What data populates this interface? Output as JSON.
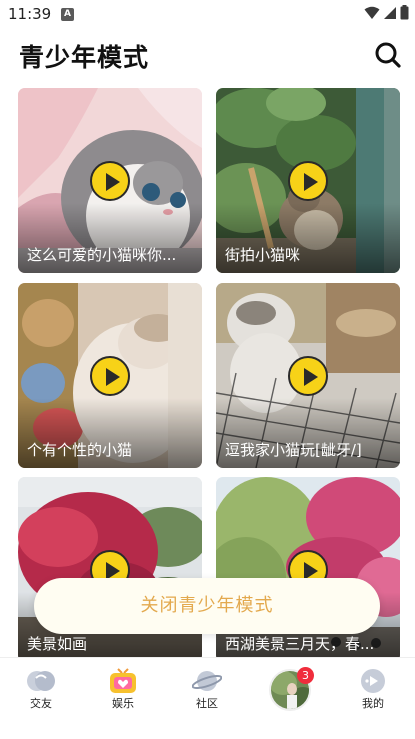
{
  "status_bar": {
    "time": "11:39",
    "app_icon": "A",
    "icons": [
      "wifi-icon",
      "cellular-signal-icon",
      "battery-icon"
    ]
  },
  "header": {
    "title": "青少年模式",
    "search_icon": "search-icon"
  },
  "videos": [
    {
      "title": "这么可爱的小猫咪你..."
    },
    {
      "title": "街拍小猫咪"
    },
    {
      "title": "个有个性的小猫"
    },
    {
      "title": "逗我家小猫玩[龇牙/]"
    },
    {
      "title": "美景如画"
    },
    {
      "title": "西湖美景三月天，春..."
    }
  ],
  "close_button": {
    "label": "关闭青少年模式"
  },
  "bottom_nav": {
    "items": [
      {
        "label": "交友",
        "icon": "friends-icon"
      },
      {
        "label": "娱乐",
        "icon": "tv-icon"
      },
      {
        "label": "社区",
        "icon": "planet-icon"
      },
      {
        "label": "",
        "icon": "avatar"
      },
      {
        "label": "我的",
        "icon": "message-icon"
      }
    ],
    "badge_count": "3"
  },
  "colors": {
    "play_button": "#f7d218",
    "close_button_text": "#e3a94e",
    "badge": "#f02d3c",
    "tv_icon": "#f7c12e"
  }
}
